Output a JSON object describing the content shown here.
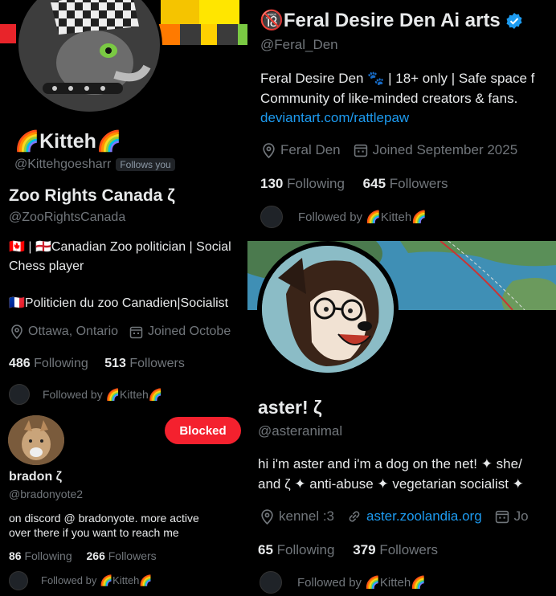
{
  "card_kitteh": {
    "display_name": "🌈Kitteh🌈",
    "handle": "@Kittehgoesharr",
    "follows_you": "Follows you"
  },
  "card_zoo": {
    "display_name": "Zoo Rights Canada ζ",
    "handle": "@ZooRightsCanada",
    "bio_line1": "🇨🇦 | 🏴󠁧󠁢󠁥󠁮󠁧󠁿Canadian Zoo politician | Social",
    "bio_line2": "Chess player",
    "bio_line3": "🇫🇷Politicien du zoo Canadien|Socialist",
    "location": "Ottawa, Ontario",
    "joined": "Joined Octobe",
    "following_count": "486",
    "following_label": "Following",
    "followers_count": "513",
    "followers_label": "Followers",
    "followed_by": "Followed by 🌈Kitteh🌈"
  },
  "card_bradon": {
    "display_name": "bradon ζ",
    "handle": "@bradonyote2",
    "blocked_label": "Blocked",
    "bio_line1": "on discord @ bradonyote. more active",
    "bio_line2": "over there if you want to reach me",
    "following_count": "86",
    "following_label": "Following",
    "followers_count": "266",
    "followers_label": "Followers",
    "followed_by": "Followed by 🌈Kitteh🌈"
  },
  "card_feral": {
    "display_name": "🔞Feral Desire Den Ai arts",
    "handle": "@Feral_Den",
    "bio_line1": "Feral Desire Den 🐾 | 18+ only | Safe space f",
    "bio_line2": "Community of like-minded creators & fans.",
    "link": "deviantart.com/rattlepaw",
    "location": "Feral Den",
    "joined": "Joined September 2025",
    "following_count": "130",
    "following_label": "Following",
    "followers_count": "645",
    "followers_label": "Followers",
    "followed_by": "Followed by 🌈Kitteh🌈"
  },
  "card_aster": {
    "display_name": "aster! ζ",
    "handle": "@asteranimal",
    "bio_line1": "hi i'm aster and i'm a dog on the net! ✦ she/",
    "bio_line2": "and ζ ✦ anti-abuse ✦ vegetarian socialist ✦",
    "location": "kennel :3",
    "link": "aster.zoolandia.org",
    "joined": "Jo",
    "following_count": "65",
    "following_label": "Following",
    "followers_count": "379",
    "followers_label": "Followers",
    "followed_by": "Followed by 🌈Kitteh🌈"
  },
  "colors": {
    "background": "#000000",
    "text_primary": "#e7e9ea",
    "text_secondary": "#71767b",
    "link": "#1d9bf0",
    "blocked": "#f4212e",
    "verified": "#1d9bf0"
  }
}
